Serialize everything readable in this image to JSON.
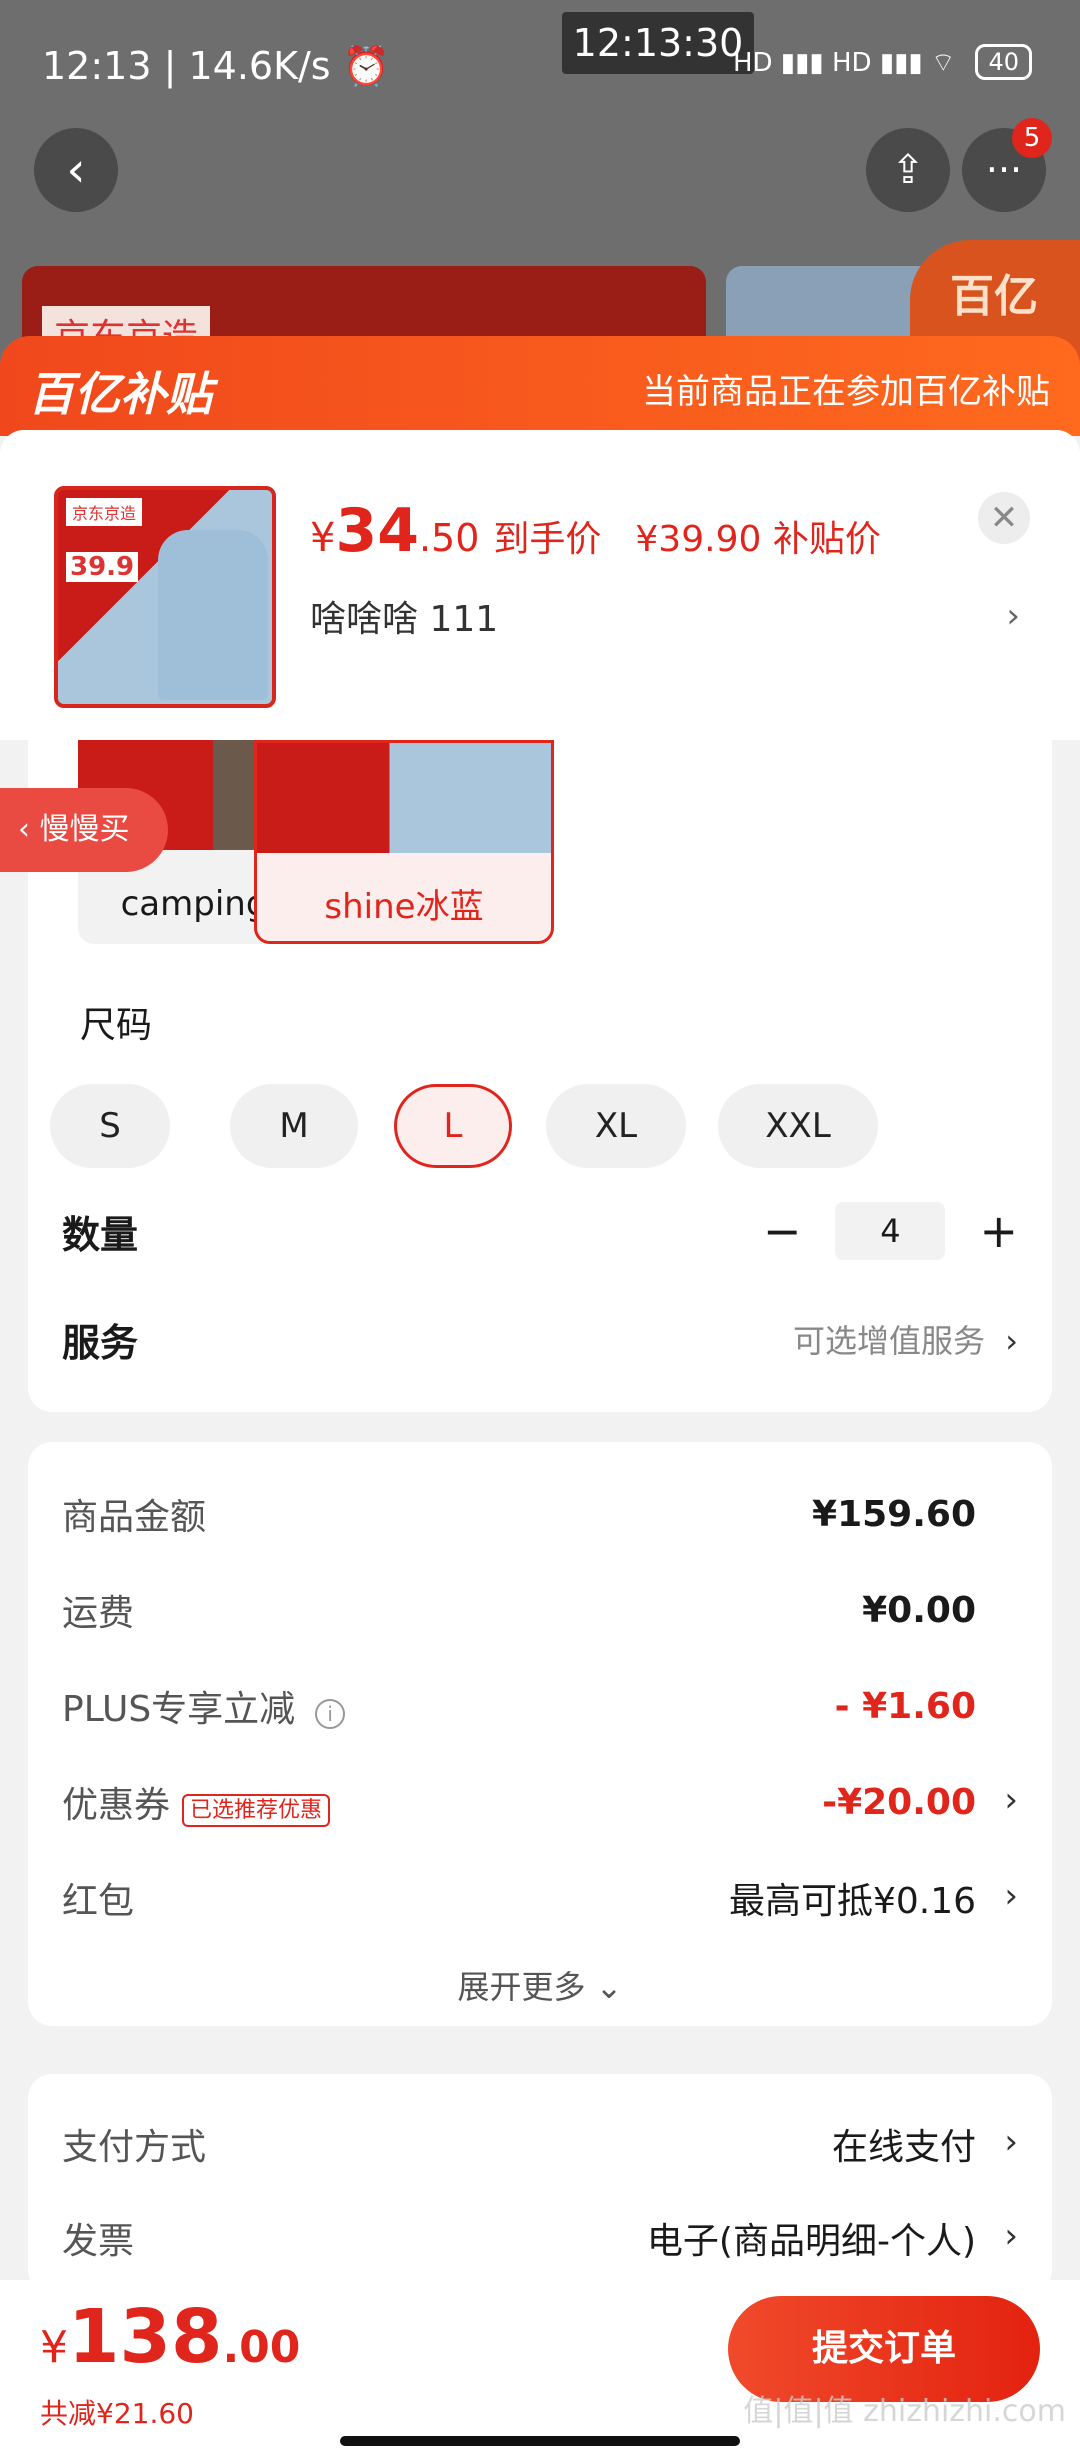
{
  "status": {
    "left": "12:13 | 14.6K/s ⏰",
    "center": "12:13:30",
    "network": "HD ▮▮▮ HD ▮▮▮ ⌔",
    "battery": "40"
  },
  "nav": {
    "back_icon": "‹",
    "share_icon": "⇪",
    "more_icon": "···",
    "more_badge": "5"
  },
  "background": {
    "banner_text": "京东京造",
    "corner_text": "百亿"
  },
  "subsidy": {
    "logo": "百亿补贴",
    "message": "当前商品正在参加百亿补贴"
  },
  "product": {
    "thumb_tag": "京东京造",
    "thumb_price": "39.9",
    "price_symbol": "¥",
    "price_int": "34",
    "price_dec": ".50",
    "price_label": "到手价",
    "subsidy_price": "¥39.90 补贴价",
    "variant": "啥啥啥  111",
    "close_icon": "✕",
    "chevron": "›"
  },
  "colors": [
    {
      "name": "camping黑色",
      "selected": false
    },
    {
      "name": "shine冰蓝",
      "selected": true
    }
  ],
  "slow_buy": "‹ 慢慢买",
  "size": {
    "title": "尺码",
    "options": [
      "S",
      "M",
      "L",
      "XL",
      "XXL"
    ],
    "selected": "L"
  },
  "quantity": {
    "label": "数量",
    "minus": "−",
    "value": "4",
    "plus": "+"
  },
  "service": {
    "label": "服务",
    "value": "可选增值服务",
    "chevron": "›"
  },
  "costs": {
    "goods_label": "商品金额",
    "goods_value": "¥159.60",
    "shipping_label": "运费",
    "shipping_value": "¥0.00",
    "plus_label": "PLUS专享立减",
    "plus_info": "i",
    "plus_value": "- ¥1.60",
    "coupon_label": "优惠券",
    "coupon_tag": "已选推荐优惠",
    "coupon_value": "-¥20.00",
    "redpacket_label": "红包",
    "redpacket_value": "最高可抵¥0.16",
    "expand": "展开更多 ⌄"
  },
  "payment": {
    "pay_label": "支付方式",
    "pay_value": "在线支付",
    "invoice_label": "发票",
    "invoice_value": "电子(商品明细-个人)"
  },
  "bottom": {
    "yen": "¥",
    "total_int": "138",
    "total_dec": ".00",
    "saved": "共减¥21.60",
    "submit": "提交订单"
  },
  "watermark": "值|值|值 zhizhizhi.com",
  "colors_theme": {
    "accent": "#e0261c",
    "subsidy_start": "#f0481c",
    "subsidy_end": "#ff6a1e"
  }
}
